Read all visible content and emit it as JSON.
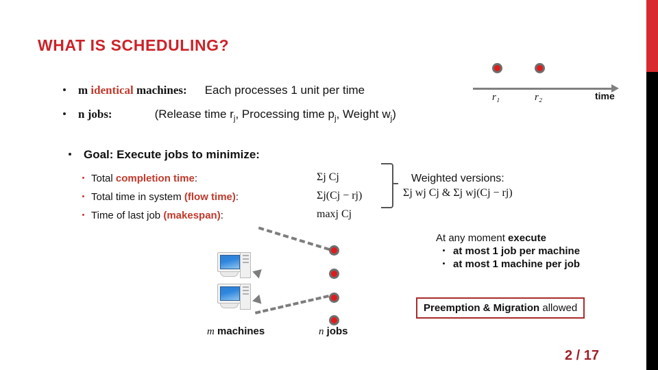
{
  "slide": {
    "title": "WHAT IS SCHEDULING?",
    "accent_red": "#cc2229",
    "dark_red": "#a02128",
    "page_label": "2  / 17"
  },
  "bullets": {
    "machines": {
      "lead_pre": "m ",
      "lead_hl": "identical",
      "lead_post": " machines:",
      "body": "Each processes 1 unit per time"
    },
    "jobs": {
      "lead": "n jobs:",
      "body_open": "(Release time r",
      "body_sub1": "j",
      "body_mid": ", Processing time p",
      "body_sub2": "j",
      "body_mid2": ", Weight w",
      "body_sub3": "j",
      "body_close": ")"
    }
  },
  "goal": {
    "heading": "Goal: Execute jobs to minimize:",
    "items": [
      {
        "pre": "Total ",
        "hl": "completion time",
        "post": ":",
        "formula": "Σj Cj"
      },
      {
        "pre": "Total time in system ",
        "hl": "(flow time)",
        "post": ":",
        "formula": "Σj(Cj − rj)"
      },
      {
        "pre": "Time of last job ",
        "hl": "(makespan)",
        "post": ":",
        "formula": "maxj Cj"
      }
    ],
    "formulas": [
      {
        "sum": "Σ",
        "sub": "j",
        "body": "C",
        "body_sub": "j"
      },
      {
        "sum": "Σ",
        "sub": "j",
        "body": "(C",
        "body_sub": "j"
      },
      {
        "sum": "max",
        "sub": "j",
        "body": "C",
        "body_sub": "j"
      }
    ]
  },
  "weighted": {
    "label": "Weighted versions:",
    "formula": "Σj wj Cj  &  Σj wj(Cj − rj)"
  },
  "timeline": {
    "label_r1": "r₁",
    "label_r2": "r₂",
    "axis_label": "time",
    "dots": 2
  },
  "moment": {
    "head_pre": "At any moment ",
    "head_bold": "execute",
    "rules": [
      "at most 1 job per machine",
      "at most 1 machine per job"
    ]
  },
  "preemption": {
    "bold": "Preemption & Migration",
    "rest": " allowed",
    "border_color": "#a92b2b"
  },
  "diagram": {
    "machines_label_it": "m",
    "machines_label": " machines",
    "jobs_label_it": "n",
    "jobs_label": " jobs",
    "machine_count": 2,
    "job_count": 4,
    "job_color": "#e01b1b",
    "job_ring": "#6e6e6e",
    "arrow_color": "#7d7d7d"
  }
}
